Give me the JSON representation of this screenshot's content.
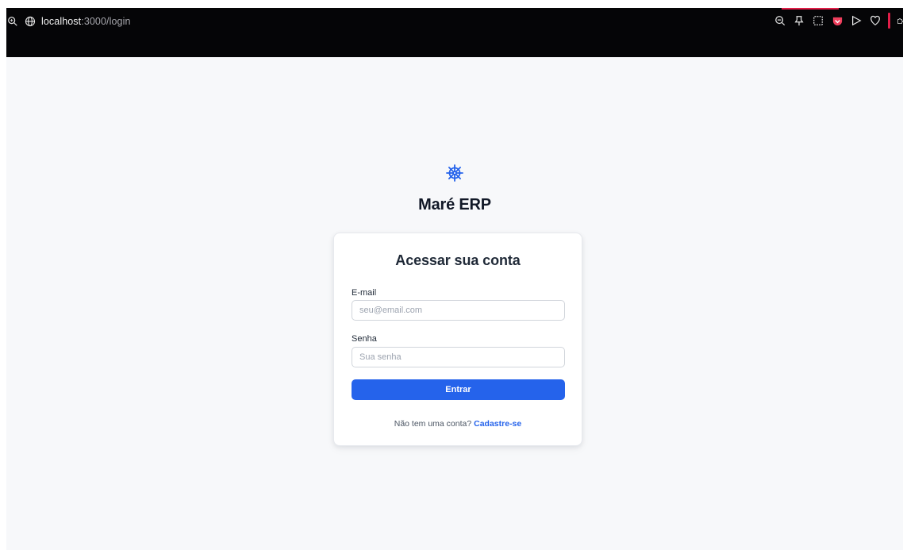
{
  "browser": {
    "url_host": "localhost",
    "url_path": ":3000/login",
    "toolbar_icons": [
      "zoom-out-icon",
      "pin-icon",
      "screenshot-icon",
      "pocket-icon",
      "send-icon",
      "heart-icon",
      "extension-icon"
    ],
    "accent_color": "#e11d48"
  },
  "brand": {
    "icon": "ship-wheel-icon",
    "title": "Maré ERP",
    "color": "#2563eb"
  },
  "login": {
    "title": "Acessar sua conta",
    "email_label": "E-mail",
    "email_placeholder": "seu@email.com",
    "email_value": "",
    "password_label": "Senha",
    "password_placeholder": "Sua senha",
    "password_value": "",
    "submit_label": "Entrar",
    "signup_prompt": "Não tem uma conta?",
    "signup_link": "Cadastre-se",
    "primary_color": "#2563eb"
  }
}
